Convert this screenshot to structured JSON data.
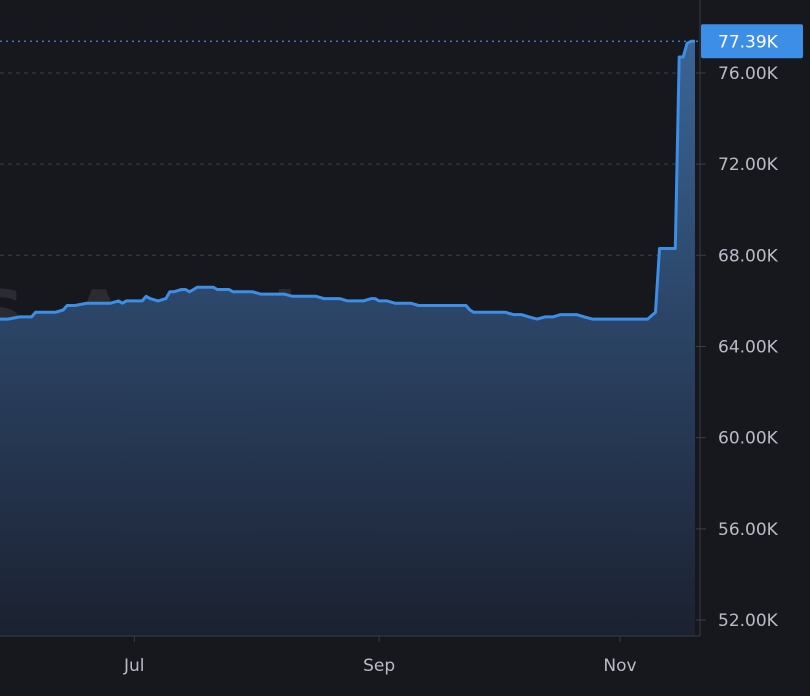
{
  "watermark": "SARI",
  "colors": {
    "background": "#17181d",
    "line": "#3d8ee6",
    "area_top": "#3a6496",
    "area_bottom": "#1b2130",
    "grid": "#3a3d47",
    "axis_text": "#b9bcc6",
    "last_label_bg": "#3d8ee6"
  },
  "chart_data": {
    "type": "area",
    "title": "",
    "xlabel": "",
    "ylabel": "",
    "ylim": [
      51300,
      79200
    ],
    "y_ticks": [
      {
        "value": 52000,
        "label": "52.00K"
      },
      {
        "value": 56000,
        "label": "56.00K"
      },
      {
        "value": 60000,
        "label": "60.00K"
      },
      {
        "value": 64000,
        "label": "64.00K"
      },
      {
        "value": 68000,
        "label": "68.00K"
      },
      {
        "value": 72000,
        "label": "72.00K"
      },
      {
        "value": 76000,
        "label": "76.00K"
      }
    ],
    "x_ticks": [
      {
        "day": 52,
        "label": "Jul"
      },
      {
        "day": 114,
        "label": "Sep"
      },
      {
        "day": 175,
        "label": "Nov"
      }
    ],
    "xlim": [
      18,
      194
    ],
    "last_value": 77390,
    "last_value_label": "77.39K",
    "grid": true,
    "series": [
      {
        "x": [
          18,
          20,
          23,
          26,
          27,
          30,
          32,
          34,
          35,
          37,
          40,
          43,
          46,
          48,
          49,
          50,
          52,
          54,
          55,
          56,
          58,
          60,
          61,
          62,
          64,
          65,
          66,
          67,
          68,
          69,
          70,
          71,
          72,
          73,
          74,
          75,
          76,
          77,
          78,
          79,
          80,
          82,
          84,
          86,
          88,
          90,
          92,
          94,
          96,
          98,
          100,
          102,
          104,
          106,
          108,
          110,
          112,
          113,
          114,
          116,
          118,
          120,
          122,
          124,
          126,
          128,
          130,
          132,
          134,
          136,
          137,
          138,
          140,
          142,
          144,
          146,
          148,
          150,
          152,
          154,
          156,
          158,
          160,
          162,
          164,
          166,
          168,
          170,
          172,
          174,
          176,
          178,
          180,
          182,
          184,
          185,
          186,
          187,
          188,
          189,
          190,
          191,
          192,
          193,
          194
        ],
        "values": [
          65200,
          65200,
          65300,
          65300,
          65500,
          65500,
          65500,
          65600,
          65800,
          65800,
          65900,
          65900,
          65900,
          66000,
          65900,
          66000,
          66000,
          66000,
          66200,
          66100,
          66000,
          66100,
          66400,
          66400,
          66500,
          66500,
          66400,
          66500,
          66600,
          66600,
          66600,
          66600,
          66600,
          66500,
          66500,
          66500,
          66500,
          66400,
          66400,
          66400,
          66400,
          66400,
          66300,
          66300,
          66300,
          66300,
          66200,
          66200,
          66200,
          66200,
          66100,
          66100,
          66100,
          66000,
          66000,
          66000,
          66100,
          66100,
          66000,
          66000,
          65900,
          65900,
          65900,
          65800,
          65800,
          65800,
          65800,
          65800,
          65800,
          65800,
          65600,
          65500,
          65500,
          65500,
          65500,
          65500,
          65400,
          65400,
          65300,
          65200,
          65300,
          65300,
          65400,
          65400,
          65400,
          65300,
          65200,
          65200,
          65200,
          65200,
          65200,
          65200,
          65200,
          65200,
          65500,
          68300,
          68300,
          68300,
          68300,
          68300,
          76700,
          76700,
          77300,
          77390,
          77390
        ]
      }
    ]
  }
}
